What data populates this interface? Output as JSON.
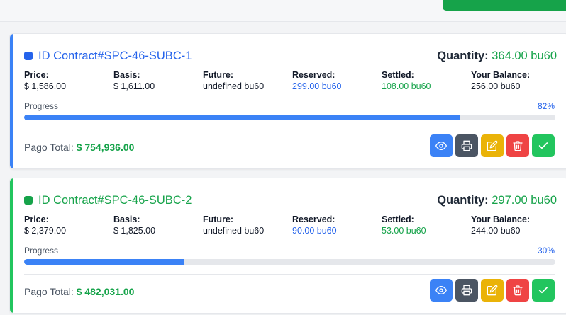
{
  "colors": {
    "blue": "#2563eb",
    "green": "#16a34a",
    "progress_fill": "#3b82f6",
    "view_button": "#3b82f6",
    "print_button": "#4b5563",
    "edit_button": "#eab308",
    "delete_button": "#ef4444",
    "approve_button": "#22c55e"
  },
  "labels": {
    "price": "Price:",
    "basis": "Basis:",
    "future": "Future:",
    "reserved": "Reserved:",
    "settled": "Settled:",
    "your_balance": "Your Balance:",
    "progress": "Progress",
    "quantity": "Quantity:",
    "pago_total": "Pago Total:"
  },
  "contracts": [
    {
      "title": "ID Contract#SPC-46-SUBC-1",
      "status_color": "#2563eb",
      "accent_color": "#3b82f6",
      "title_color": "#2563eb",
      "quantity": "364.00 bu60",
      "price": "$ 1,586.00",
      "basis": "$ 1,611.00",
      "future": "undefined bu60",
      "reserved": "299.00 bu60",
      "settled": "108.00 bu60",
      "your_balance": "256.00 bu60",
      "progress_text": "82%",
      "progress_fraction": 0.82,
      "pago_total": "$ 754,936.00"
    },
    {
      "title": "ID Contract#SPC-46-SUBC-2",
      "status_color": "#16a34a",
      "accent_color": "#22c55e",
      "title_color": "#16a34a",
      "quantity": "297.00 bu60",
      "price": "$ 2,379.00",
      "basis": "$ 1,825.00",
      "future": "undefined bu60",
      "reserved": "90.00 bu60",
      "settled": "53.00 bu60",
      "your_balance": "244.00 bu60",
      "progress_text": "30%",
      "progress_fraction": 0.3,
      "pago_total": "$ 482,031.00"
    }
  ],
  "icons": {
    "view": "eye-icon",
    "print": "printer-icon",
    "edit": "edit-icon",
    "delete": "trash-icon",
    "approve": "check-icon"
  }
}
